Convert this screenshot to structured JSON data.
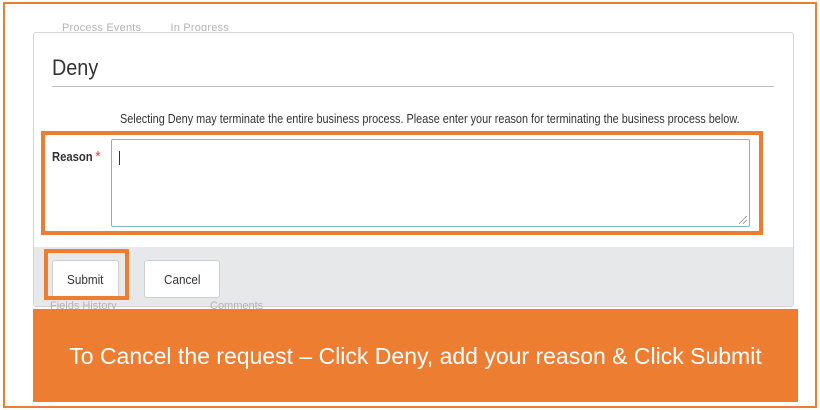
{
  "background_fragments": {
    "top": [
      "Process Events",
      "In Progress"
    ],
    "bottom_left": "Fields History",
    "bottom_right": "Comments"
  },
  "dialog": {
    "title": "Deny",
    "warning": "Selecting Deny may terminate the entire business process. Please enter your reason for terminating the business process below.",
    "reason_label": "Reason",
    "required_marker": "*",
    "reason_value": ""
  },
  "buttons": {
    "submit": "Submit",
    "cancel": "Cancel"
  },
  "caption": {
    "text": "To Cancel the request – Click Deny, add your reason & Click Submit"
  },
  "colors": {
    "highlight": "#ed7d31",
    "caption_background": "#ed7d31",
    "required": "#d43f3a",
    "textarea_border": "#7fb5c9",
    "footer_background": "#e6e8ea"
  }
}
